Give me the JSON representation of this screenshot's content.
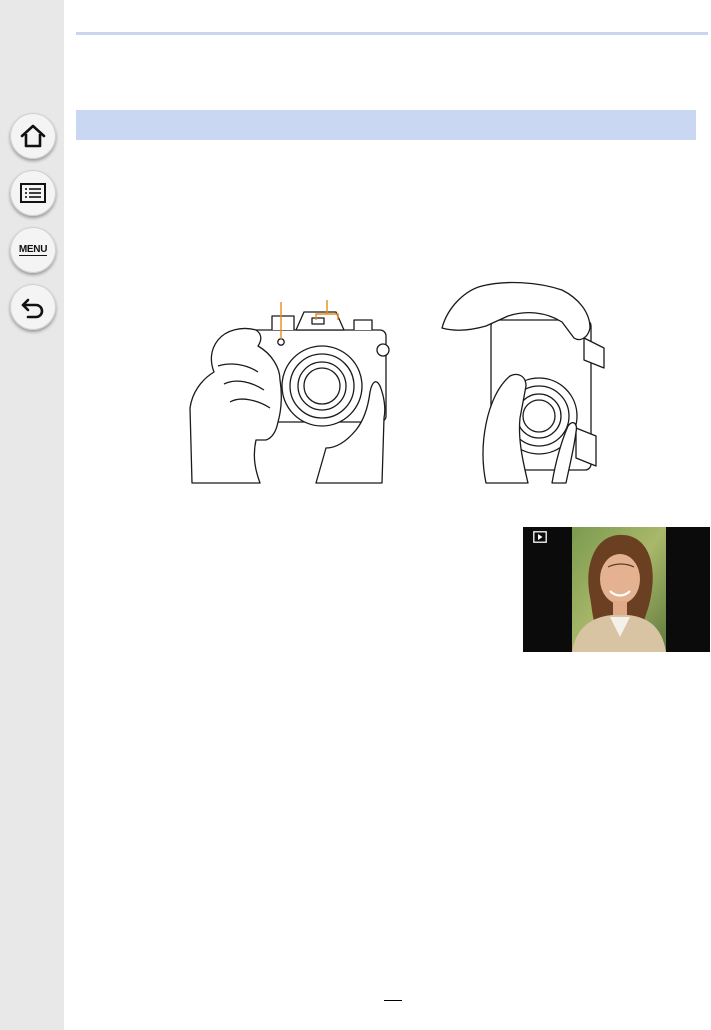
{
  "sidebar": {
    "items": [
      {
        "name": "home",
        "icon": "home-icon"
      },
      {
        "name": "contents",
        "icon": "list-icon"
      },
      {
        "name": "menu",
        "icon": "menu-icon",
        "label": "MENU"
      },
      {
        "name": "back",
        "icon": "back-arrow-icon"
      }
    ]
  },
  "colors": {
    "section_bar": "#c9d7f2",
    "top_rule": "#c9d6ee",
    "sidebar": "#e8e8e8",
    "callout": "#e88a1a"
  }
}
